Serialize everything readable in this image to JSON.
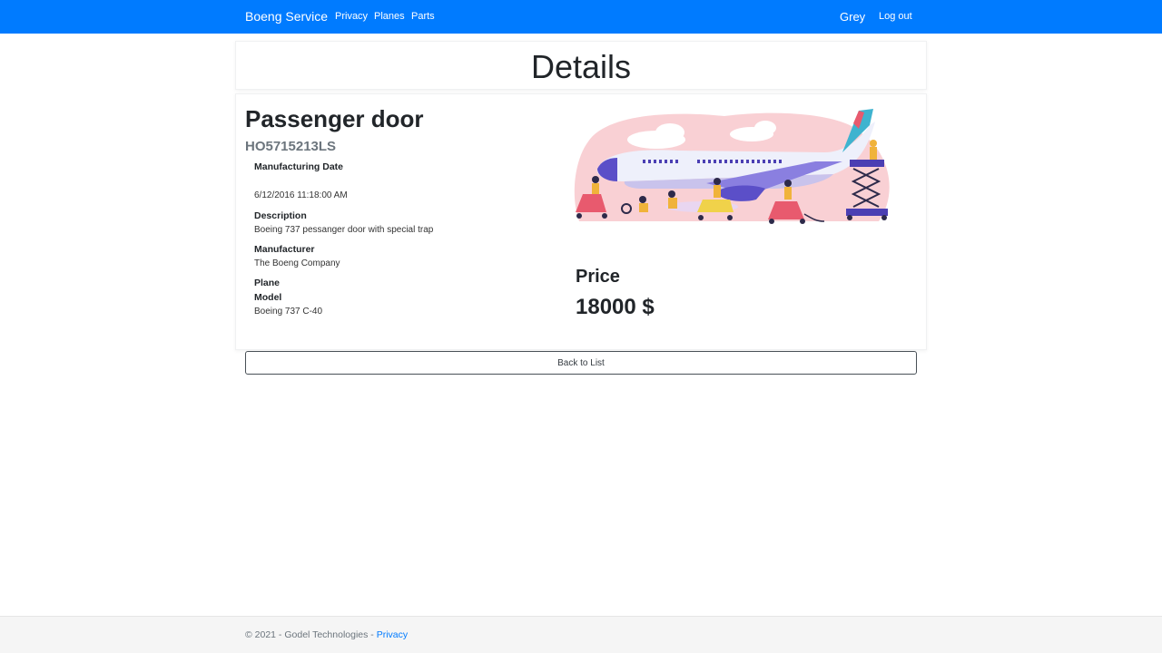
{
  "navbar": {
    "brand": "Boeng Service",
    "links": [
      "Privacy",
      "Planes",
      "Parts"
    ],
    "user": "Grey",
    "logout": "Log out",
    "bg_color": "#007bff"
  },
  "page": {
    "title": "Details"
  },
  "part": {
    "name": "Passenger door",
    "code": "HO5715213LS",
    "fields": [
      {
        "label": "Manufacturing Date",
        "value": "6/12/2016 11:18:00 AM"
      },
      {
        "label": "Description",
        "value": "Boeing 737 pessanger door with special trap"
      },
      {
        "label": "Manufacturer",
        "value": "The Boeng Company"
      },
      {
        "label": "Plane Model",
        "value": "Boeing 737 C-40"
      }
    ],
    "price_label": "Price",
    "price_value": "18000 $",
    "illustration_icon": "airplane-maintenance-illustration"
  },
  "actions": {
    "back_label": "Back to List"
  },
  "footer": {
    "copyright": "© 2021 - Godel Technologies - ",
    "privacy_link": "Privacy"
  }
}
